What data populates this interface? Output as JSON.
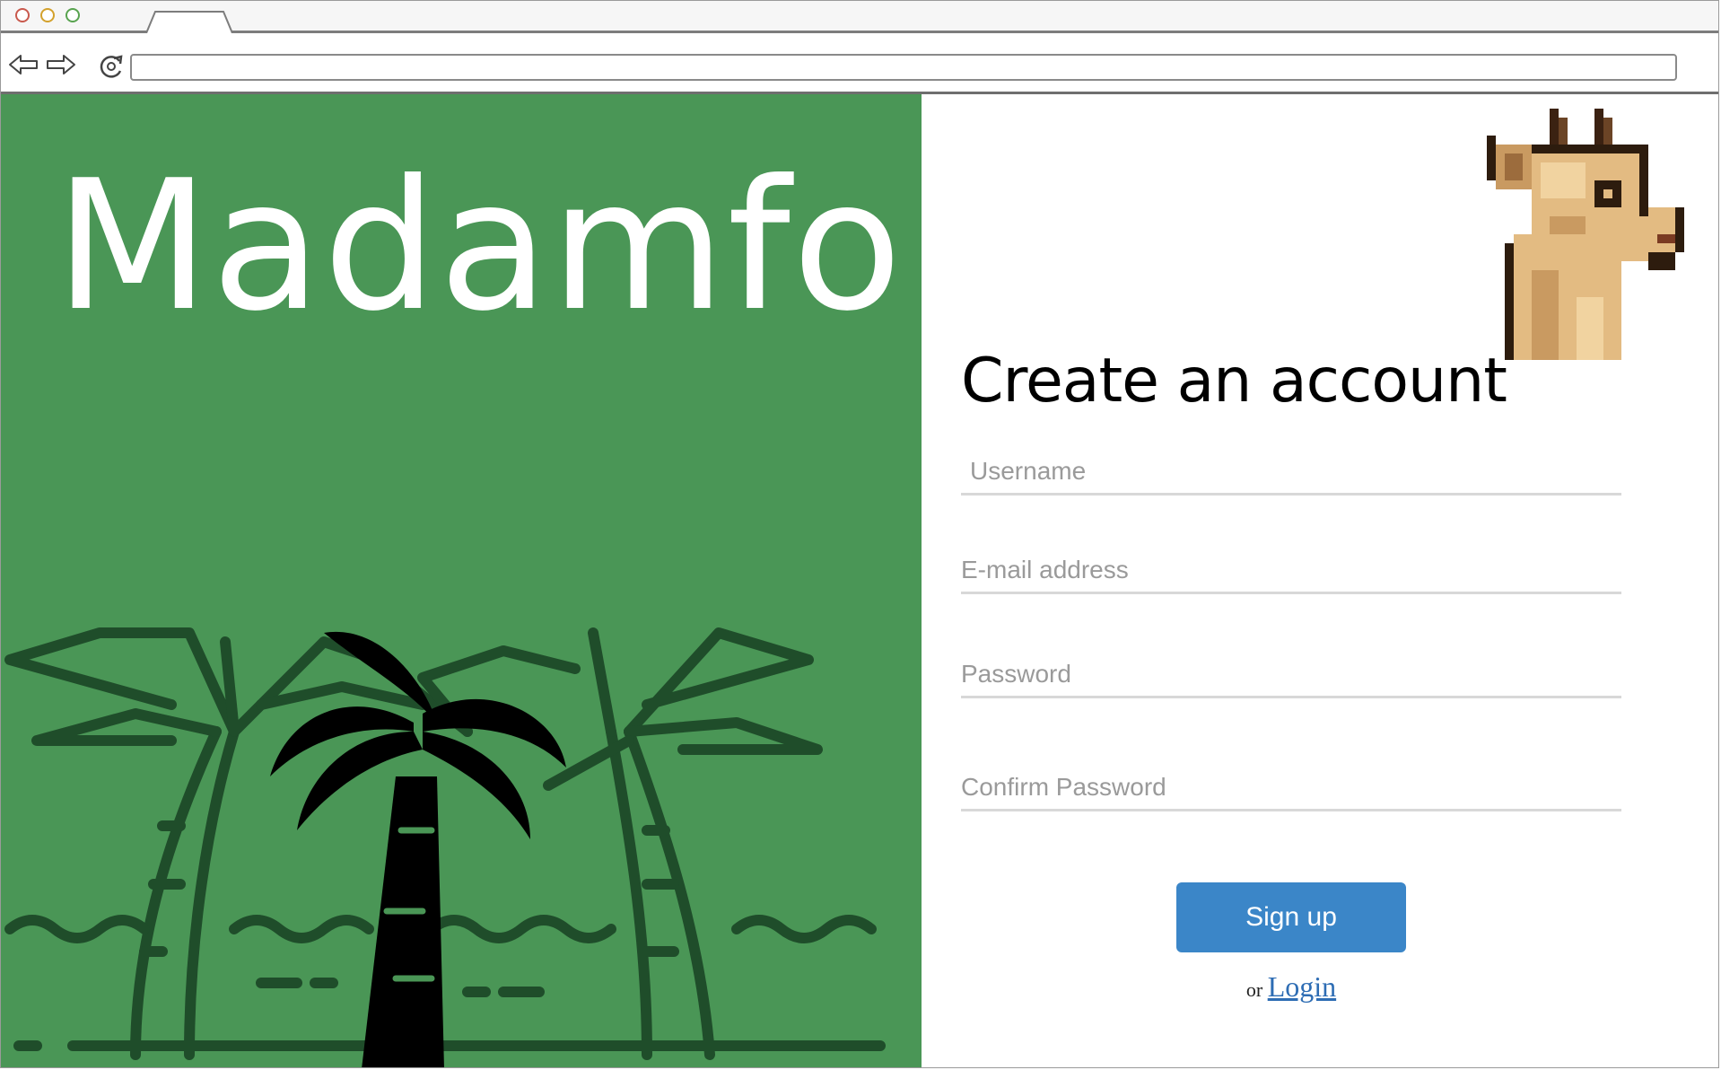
{
  "browser": {
    "url": "",
    "back_icon": "back-arrow-icon",
    "forward_icon": "forward-arrow-icon",
    "reload_icon": "reload-icon"
  },
  "brand": {
    "title": "Madamfo",
    "accent_color": "#4a9656"
  },
  "illustration": {
    "name": "palm-trees-beach-icon",
    "mascot": "pixel-goat-icon"
  },
  "form": {
    "heading": "Create an account",
    "fields": {
      "username_placeholder": "Username",
      "email_placeholder": "E-mail address",
      "password_placeholder": "Password",
      "confirm_password_placeholder": "Confirm Password"
    },
    "signup_label": "Sign up",
    "signup_color": "#3b86c8",
    "login_prefix": "or",
    "login_label": "Login"
  }
}
